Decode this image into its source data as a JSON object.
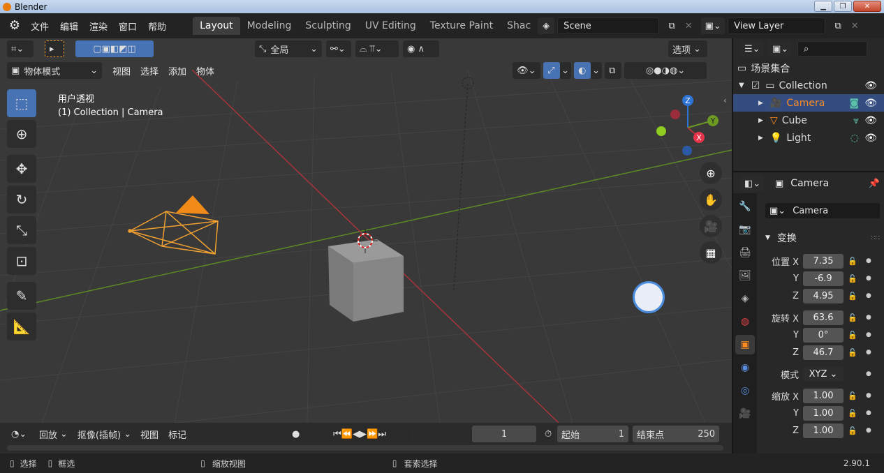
{
  "window": {
    "title": "Blender"
  },
  "menu": [
    "文件",
    "编辑",
    "渲染",
    "窗口",
    "帮助"
  ],
  "workspaces": [
    "Layout",
    "Modeling",
    "Sculpting",
    "UV Editing",
    "Texture Paint",
    "Shac"
  ],
  "scene": {
    "name": "Scene",
    "view_layer": "View Layer"
  },
  "viewport_header": {
    "transform_orientation": "全局",
    "options_label": "选项",
    "mode": "物体模式",
    "menus": [
      "视图",
      "选择",
      "添加",
      "物体"
    ]
  },
  "viewport": {
    "view_name": "用户透视",
    "view_context": "(1) Collection | Camera",
    "gizmo": {
      "x": "X",
      "y": "Y",
      "z": "Z"
    }
  },
  "timeline": {
    "menus": [
      "回放",
      "抠像(插帧)",
      "视图",
      "标记"
    ],
    "current_frame": "1",
    "start_label": "起始",
    "start": "1",
    "end_label": "结束点",
    "end": "250"
  },
  "statusbar": {
    "items": [
      "选择",
      "框选",
      "缩放视图",
      "套索选择"
    ],
    "version": "2.90.1"
  },
  "outliner": {
    "root": "场景集合",
    "collection": "Collection",
    "items": [
      {
        "name": "Camera",
        "selected": true
      },
      {
        "name": "Cube",
        "selected": false
      },
      {
        "name": "Light",
        "selected": false
      }
    ]
  },
  "properties": {
    "object_name": "Camera",
    "datablock": "Camera",
    "panel": "变换",
    "location": {
      "label": "位置 X",
      "x": "7.35",
      "y": "-6.9",
      "z": "4.95"
    },
    "rotation": {
      "label": "旋转 X",
      "x": "63.6",
      "y": "0°",
      "z": "46.7"
    },
    "mode_label": "模式",
    "mode": "XYZ",
    "scale": {
      "label": "缩放 X",
      "x": "1.00",
      "y": "1.00",
      "z": "1.00"
    },
    "axis_y": "Y",
    "axis_z": "Z"
  },
  "colors": {
    "accent": "#4772b3",
    "selected_orange": "#ff8c21",
    "x_axis": "#b3343a",
    "y_axis": "#6c9a22",
    "z_axis": "#2d74d6"
  }
}
